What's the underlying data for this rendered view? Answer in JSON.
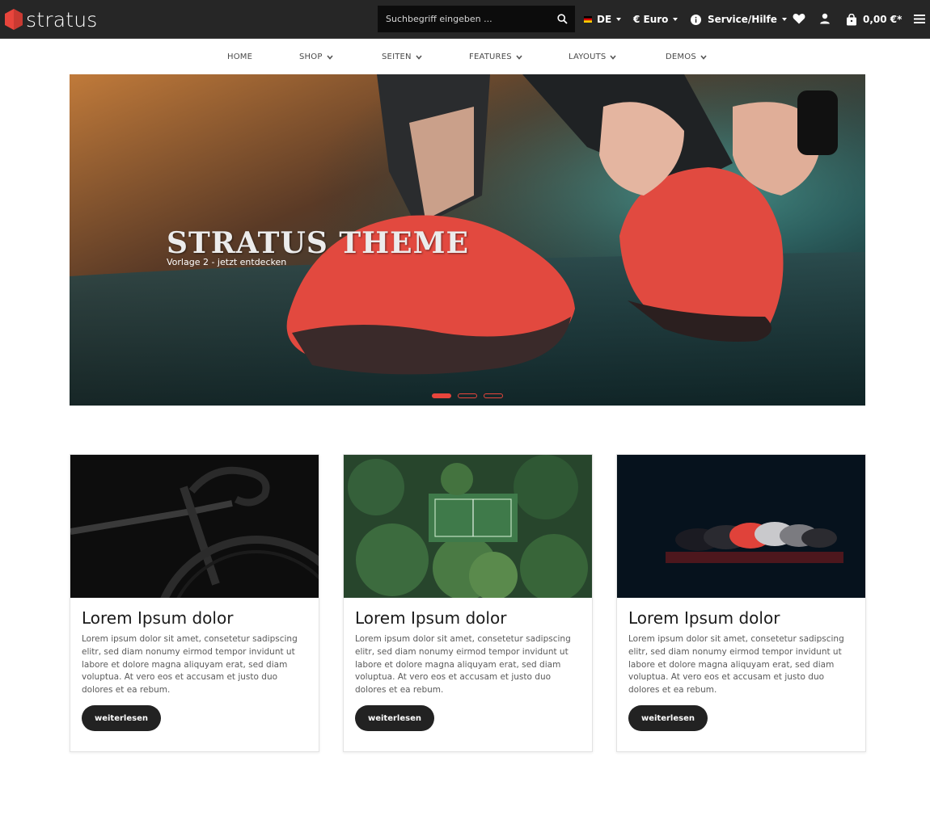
{
  "header": {
    "logo_text": "stratus",
    "search_placeholder": "Suchbegriff eingeben ...",
    "language": "DE",
    "currency": "€ Euro",
    "service": "Service/Hilfe",
    "cart_total": "0,00 €*"
  },
  "nav": {
    "items": [
      {
        "label": "Home",
        "has_dropdown": false
      },
      {
        "label": "Shop",
        "has_dropdown": true
      },
      {
        "label": "Seiten",
        "has_dropdown": true
      },
      {
        "label": "Features",
        "has_dropdown": true
      },
      {
        "label": "Layouts",
        "has_dropdown": true
      },
      {
        "label": "Demos",
        "has_dropdown": true
      }
    ]
  },
  "hero": {
    "title": "STRATUS THEME",
    "subtitle": "Vorlage 2 - jetzt entdecken",
    "slide_count": 3,
    "active_slide": 1
  },
  "cards": [
    {
      "image": "bicycle-photo",
      "title": "Lorem Ipsum dolor",
      "text": "Lorem ipsum dolor sit amet, consetetur sadipscing elitr, sed diam nonumy eirmod tempor invidunt ut labore et dolore magna aliquyam erat, sed diam voluptua. At vero eos et accusam et justo duo dolores et ea rebum.",
      "button": "weiterlesen"
    },
    {
      "image": "tennis-court-aerial-photo",
      "title": "Lorem Ipsum dolor",
      "text": "Lorem ipsum dolor sit amet, consetetur sadipscing elitr, sed diam nonumy eirmod tempor invidunt ut labore et dolore magna aliquyam erat, sed diam voluptua. At vero eos et accusam et justo duo dolores et ea rebum.",
      "button": "weiterlesen"
    },
    {
      "image": "sneakers-row-photo",
      "title": "Lorem Ipsum dolor",
      "text": "Lorem ipsum dolor sit amet, consetetur sadipscing elitr, sed diam nonumy eirmod tempor invidunt ut labore et dolore magna aliquyam erat, sed diam voluptua. At vero eos et accusam et justo duo dolores et ea rebum.",
      "button": "weiterlesen"
    }
  ],
  "colors": {
    "topbar": "#262626",
    "accent": "#e8453c",
    "button": "#222222"
  }
}
